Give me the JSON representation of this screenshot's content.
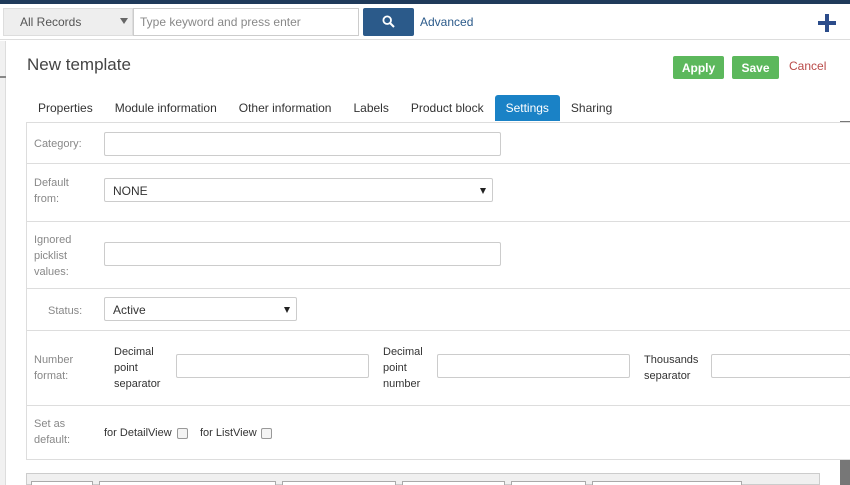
{
  "topbar": {
    "records_select": "All Records",
    "search_placeholder": "Type keyword and press enter",
    "advanced_label": "Advanced"
  },
  "header": {
    "title": "New template",
    "apply_label": "Apply",
    "save_label": "Save",
    "cancel_label": "Cancel"
  },
  "tabs": [
    {
      "label": "Properties",
      "active": false
    },
    {
      "label": "Module information",
      "active": false
    },
    {
      "label": "Other information",
      "active": false
    },
    {
      "label": "Labels",
      "active": false
    },
    {
      "label": "Product block",
      "active": false
    },
    {
      "label": "Settings",
      "active": true
    },
    {
      "label": "Sharing",
      "active": false
    }
  ],
  "form": {
    "category": {
      "label": "Category:",
      "value": ""
    },
    "default_from": {
      "label_line1": "Default",
      "label_line2": "from:",
      "value": "NONE"
    },
    "ignored_picklist": {
      "label_line1": "Ignored",
      "label_line2": "picklist",
      "label_line3": "values:",
      "value": ""
    },
    "status": {
      "label": "Status:",
      "value": "Active"
    },
    "number_format": {
      "label_line1": "Number",
      "label_line2": "format:",
      "decimal_separator": {
        "line1": "Decimal",
        "line2": "point",
        "line3": "separator",
        "value": ""
      },
      "decimal_number": {
        "line1": "Decimal",
        "line2": "point",
        "line3": "number",
        "value": ""
      },
      "thousands_separator": {
        "line1": "Thousands",
        "line2": "separator",
        "value": ""
      }
    },
    "set_default": {
      "label_line1": "Set as",
      "label_line2": "default:",
      "detailview_label": "for DetailView",
      "listview_label": "for ListView"
    }
  },
  "colors": {
    "accent": "#1a82c6",
    "success": "#5cb85c",
    "danger": "#b94a48",
    "navy": "#2b5a8a"
  }
}
